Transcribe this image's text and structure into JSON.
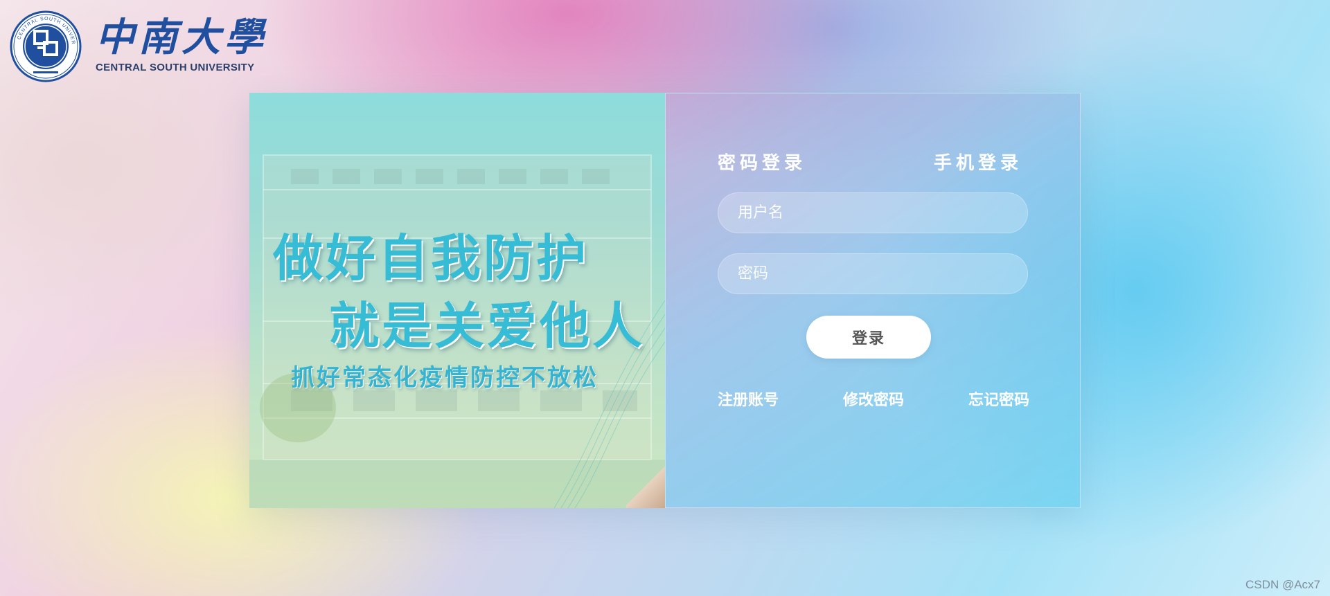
{
  "logo": {
    "cn_name": "中南大學",
    "en_name": "CENTRAL SOUTH UNIVERSITY",
    "seal_text": "CENTRAL SOUTH UNIVERSITY"
  },
  "banner": {
    "slogan_line1": "做好自我防护",
    "slogan_line2": "就是关爱他人",
    "slogan_line3": "抓好常态化疫情防控不放松"
  },
  "login": {
    "tab_password": "密码登录",
    "tab_phone": "手机登录",
    "username_placeholder": "用户名",
    "password_placeholder": "密码",
    "submit_label": "登录",
    "link_register": "注册账号",
    "link_change_password": "修改密码",
    "link_forgot_password": "忘记密码"
  },
  "watermark": "CSDN @Acx7",
  "colors": {
    "brand_blue": "#1f4f9e",
    "slogan_cyan": "#37bcd6",
    "button_text": "#555555"
  }
}
